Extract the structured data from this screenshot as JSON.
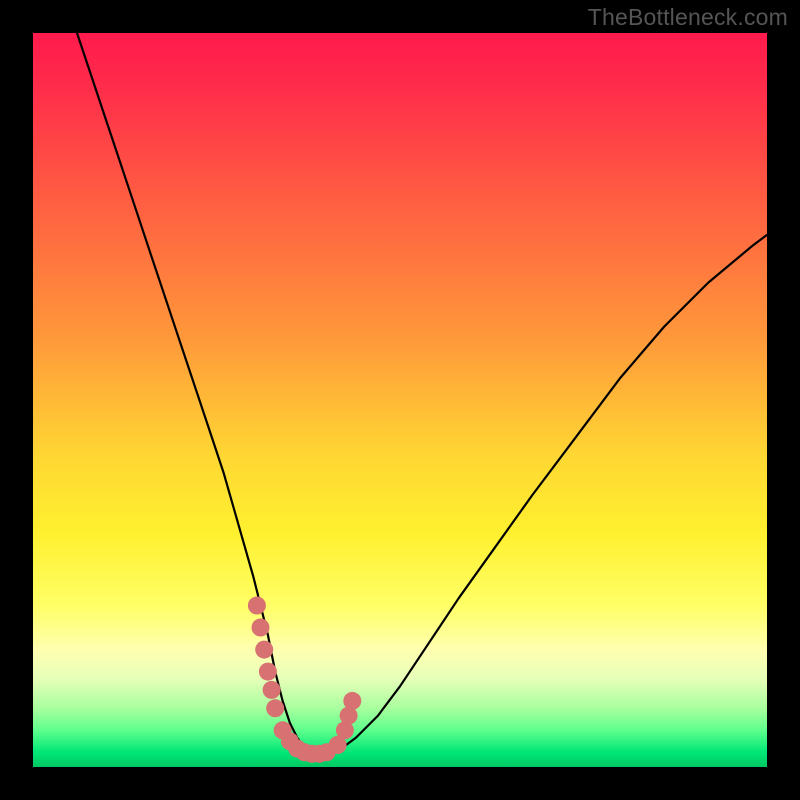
{
  "watermark": "TheBottleneck.com",
  "chart_data": {
    "type": "line",
    "title": "",
    "xlabel": "",
    "ylabel": "",
    "xlim": [
      0,
      100
    ],
    "ylim": [
      0,
      100
    ],
    "series": [
      {
        "name": "bottleneck-curve",
        "x": [
          6,
          8,
          10,
          12,
          14,
          16,
          18,
          20,
          22,
          24,
          26,
          28,
          30,
          32,
          33,
          34,
          35,
          36,
          37,
          38,
          40,
          42,
          44,
          47,
          50,
          54,
          58,
          63,
          68,
          74,
          80,
          86,
          92,
          98,
          100
        ],
        "values": [
          100,
          94,
          88,
          82,
          76,
          70,
          64,
          58,
          52,
          46,
          40,
          33,
          26,
          18,
          13,
          9,
          6,
          4,
          2.5,
          2,
          2,
          2.5,
          4,
          7,
          11,
          17,
          23,
          30,
          37,
          45,
          53,
          60,
          66,
          71,
          72.5
        ]
      }
    ],
    "markers": {
      "name": "highlight-points",
      "color": "#d87272",
      "x": [
        30.5,
        31,
        31.5,
        32,
        32.5,
        33,
        34,
        35,
        36,
        37,
        38,
        39,
        40,
        41.5,
        42.5,
        43,
        43.5
      ],
      "values": [
        22,
        19,
        16,
        13,
        10.5,
        8,
        5,
        3.5,
        2.5,
        2,
        1.8,
        1.8,
        2,
        3,
        5,
        7,
        9
      ]
    },
    "gradient_stops": [
      {
        "pos": 0,
        "color": "#ff1a4d"
      },
      {
        "pos": 20,
        "color": "#ff5543"
      },
      {
        "pos": 42,
        "color": "#ff9a3a"
      },
      {
        "pos": 68,
        "color": "#fff02f"
      },
      {
        "pos": 84,
        "color": "#ffffb0"
      },
      {
        "pos": 95,
        "color": "#5eff8c"
      },
      {
        "pos": 100,
        "color": "#00c864"
      }
    ]
  }
}
